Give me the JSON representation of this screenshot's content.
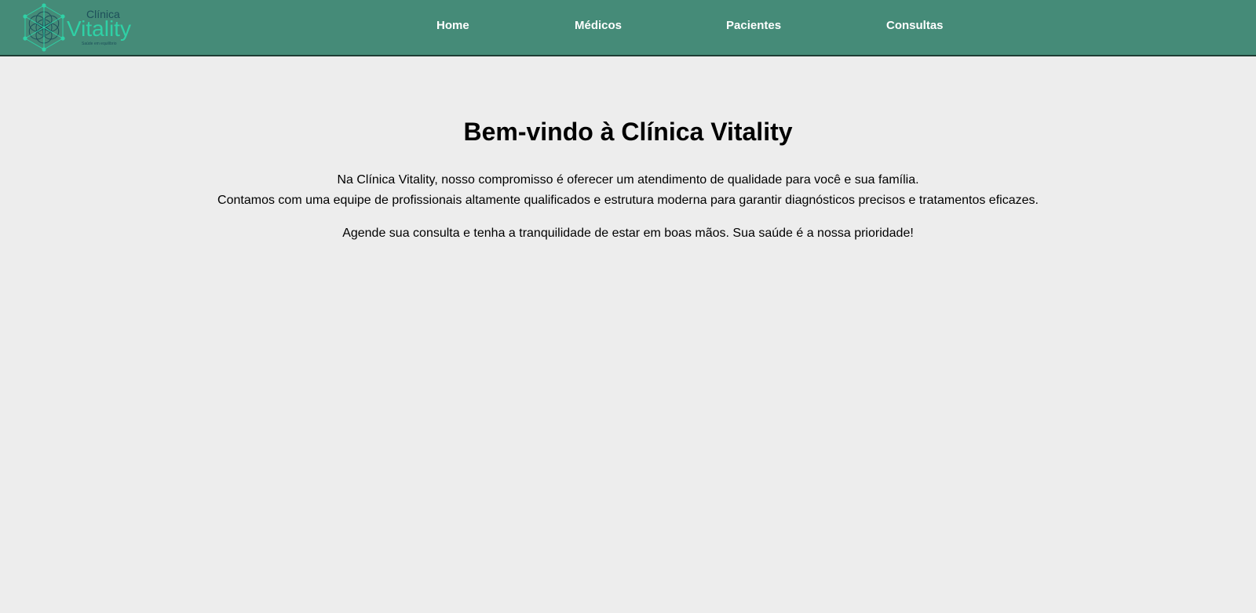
{
  "brand": {
    "line1": "Clínica",
    "line2": "Vitality",
    "tagline": "Saúde em equilíbrio",
    "colors": {
      "header_bg": "#458b78",
      "logo_teal": "#2fd1a6",
      "logo_dark": "#1d4f5a"
    }
  },
  "nav": {
    "items": [
      {
        "label": "Home"
      },
      {
        "label": "Médicos"
      },
      {
        "label": "Pacientes"
      },
      {
        "label": "Consultas"
      }
    ]
  },
  "main": {
    "title": "Bem-vindo à Clínica Vitality",
    "intro_line1": "Na Clínica Vitality, nosso compromisso é oferecer um atendimento de qualidade para você e sua família.",
    "intro_line2": "Contamos com uma equipe de profissionais altamente qualificados e estrutura moderna para garantir diagnósticos precisos e tratamentos eficazes.",
    "cta": "Agende sua consulta e tenha a tranquilidade de estar em boas mãos. Sua saúde é a nossa prioridade!"
  }
}
